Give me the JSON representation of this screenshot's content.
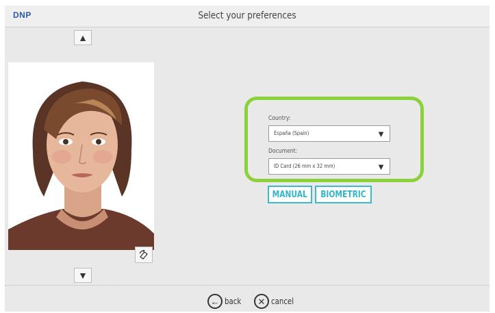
{
  "app": {
    "brand": "DNP",
    "title": "Select your preferences"
  },
  "nav": {
    "up_icon": "triangle-up-icon",
    "up_glyph": "▲",
    "down_icon": "triangle-down-icon",
    "down_glyph": "▼",
    "rotate_icon": "rotate-icon"
  },
  "photo": {
    "subject": "portrait"
  },
  "preferences": {
    "country_label": "Country:",
    "country_value": "España (Spain)",
    "document_label": "Document:",
    "document_value": "ID Card (26 mm x 32 mm)",
    "caret_glyph": "▼",
    "highlight_color": "#8ad13a"
  },
  "modes": {
    "manual_label": "MANUAL",
    "biometric_label": "BIOMETRIC",
    "accent_color": "#38bccc"
  },
  "footer": {
    "back_label": "back",
    "back_glyph": "←",
    "cancel_label": "cancel",
    "cancel_glyph": "✕"
  }
}
